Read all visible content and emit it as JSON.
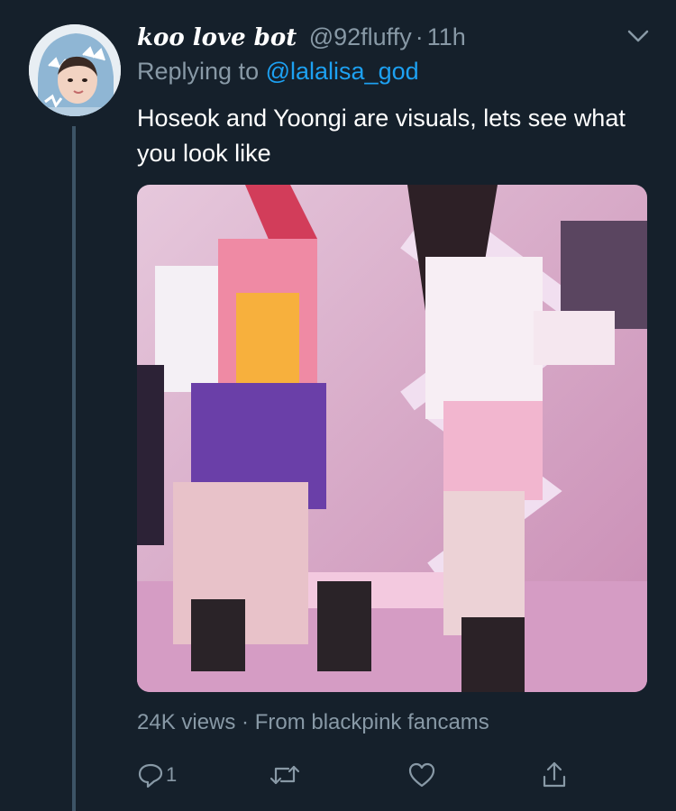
{
  "tweet": {
    "display_name": "koo love bot",
    "handle": "@92fluffy",
    "separator": "·",
    "time": "11h",
    "replying_to_label": "Replying to",
    "replying_to_handle": "@lalalisa_god",
    "text": "Hoseok and Yoongi are visuals, lets see what you look like",
    "media_meta": "24K views · From blackpink fancams",
    "reply_count": "1"
  },
  "icons": {
    "menu": "chevron-down-icon",
    "reply": "reply-icon",
    "retweet": "retweet-icon",
    "like": "heart-icon",
    "share": "share-icon"
  },
  "colors": {
    "background": "#15202b",
    "muted_text": "#8899a6",
    "link": "#1da1f2",
    "thread_line": "#3d5466"
  }
}
